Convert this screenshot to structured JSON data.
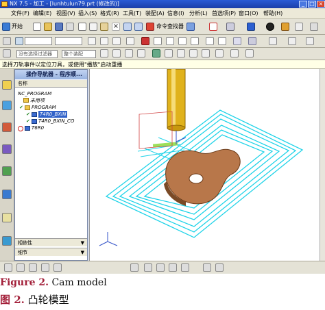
{
  "window": {
    "title": "NX 7.5 - 加工 - [lunhtulun79.prt (修改的)]"
  },
  "menubar": {
    "items": [
      "文件(F)",
      "编辑(E)",
      "视图(V)",
      "插入(S)",
      "格式(R)",
      "工具(T)",
      "装配(A)",
      "信息(I)",
      "分析(L)",
      "首选项(P)",
      "窗口(O)",
      "帮助(H)"
    ]
  },
  "toolbar": {
    "start_label": "开始",
    "combo1": "命令查找器",
    "combo_filter": "没有选择过滤器",
    "combo_assembly": "整个装配"
  },
  "status": {
    "prompt": "选择刀轨事件以定位刀具，或使用\"播放\"启动重播"
  },
  "navigator": {
    "title": "操作导航器 - 程序顺...",
    "column": "名称",
    "rows": [
      {
        "label": "NC_PROGRAM",
        "indent": 0
      },
      {
        "label": "未用项",
        "indent": 1
      },
      {
        "label": "PROGRAM",
        "indent": 1
      },
      {
        "label": "T4R0_BXIN",
        "indent": 2,
        "selected": true
      },
      {
        "label": "T4R0_BXIN_CO",
        "indent": 2
      },
      {
        "label": "T6R0",
        "indent": 1
      }
    ],
    "panel_dependency": "相依性",
    "panel_details": "细节"
  },
  "caption": {
    "en_label": "Figure 2.",
    "en_text": "Cam model",
    "cn_label": "图 2.",
    "cn_text": "凸轮模型"
  },
  "colors": {
    "titlebar": "#1b3fa8",
    "toolpath": "#1fd3e8",
    "part": "#b8774a",
    "tool": "#e0b21c",
    "caption_label": "#a3203a"
  }
}
